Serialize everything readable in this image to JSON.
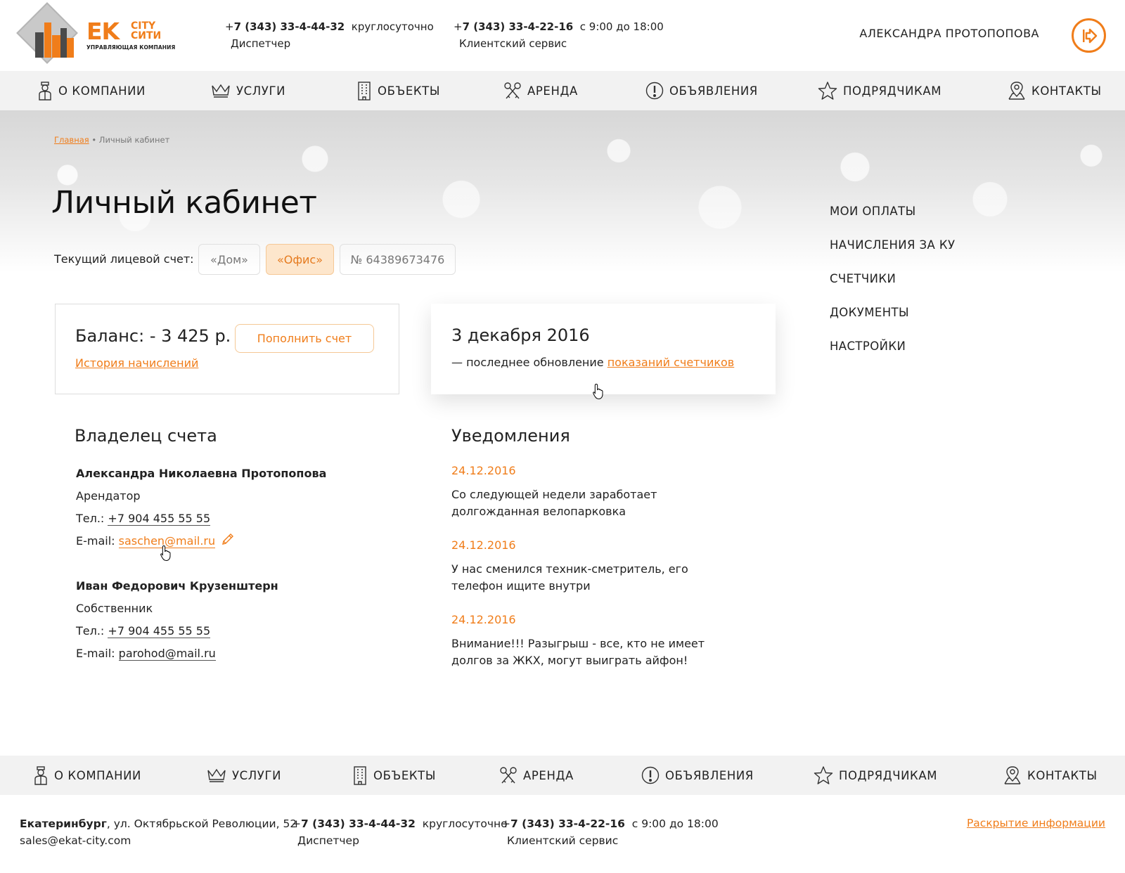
{
  "header": {
    "logo": {
      "ek": "EK",
      "city_en": "CITY",
      "city_ru": "СИТИ",
      "sub": "УПРАВЛЯЮЩАЯ КОМПАНИЯ"
    },
    "phone1": {
      "prefix": "+",
      "number": "7 (343) 33-4-44-32",
      "hours": "круглосуточно",
      "label": "Диспетчер"
    },
    "phone2": {
      "prefix": "+",
      "number": "7 (343) 33-4-22-16",
      "hours": "с 9:00 до 18:00",
      "label": "Клиентский сервис"
    },
    "user_name": "АЛЕКСАНДРА ПРОТОПОПОВА",
    "logout_icon": "logout-arrow-icon",
    "accent_color": "#f07d1a"
  },
  "nav": {
    "items": [
      {
        "label": "О КОМПАНИИ",
        "icon": "doorman-icon"
      },
      {
        "label": "УСЛУГИ",
        "icon": "crown-icon"
      },
      {
        "label": "ОБЪЕКТЫ",
        "icon": "building-icon"
      },
      {
        "label": "АРЕНДА",
        "icon": "keys-icon"
      },
      {
        "label": "ОБЪЯВЛЕНИЯ",
        "icon": "exclamation-icon"
      },
      {
        "label": "ПОДРЯДЧИКАМ",
        "icon": "star-icon"
      },
      {
        "label": "КОНТАКТЫ",
        "icon": "map-pin-icon"
      }
    ]
  },
  "breadcrumb": {
    "home": "Главная",
    "separator": "•",
    "current": "Личный кабинет"
  },
  "page_title": "Личный кабинет",
  "side_menu": [
    "МОИ ОПЛАТЫ",
    "НАЧИСЛЕНИЯ ЗА КУ",
    "СЧЕТЧИКИ",
    "ДОКУМЕНТЫ",
    "НАСТРОЙКИ"
  ],
  "account": {
    "label": "Текущий лицевой счет:",
    "options": [
      "«Дом»",
      "«Офис»",
      "№ 64389673476"
    ],
    "selected": "«Офис»"
  },
  "balance_card": {
    "balance": "Баланс: - 3 425 р.",
    "history_link": "История начислений",
    "topup_button": "Пополнить счет"
  },
  "update_card": {
    "date": "3 декабря 2016",
    "text_prefix": "— последнее обновление",
    "link": "показаний счетчиков"
  },
  "owners": {
    "title": "Владелец счета",
    "tel_label": "Тел.:",
    "email_label": "E-mail:",
    "list": [
      {
        "name": "Александра Николаевна Протопопова",
        "role": "Арендатор",
        "phone": "+7 904 455 55 55",
        "email": "saschen@mail.ru"
      },
      {
        "name": "Иван Федорович Крузенштерн",
        "role": "Собственник",
        "phone": "+7 904 455 55 55",
        "email": "parohod@mail.ru"
      }
    ]
  },
  "notifications": {
    "title": "Уведомления",
    "items": [
      {
        "date": "24.12.2016",
        "text": "Со следующей недели заработает долгожданная велопарковка"
      },
      {
        "date": "24.12.2016",
        "text": "У нас сменился техник-сметритель, его телефон ищите внутри"
      },
      {
        "date": "24.12.2016",
        "text": "Внимание!!! Разыгрыш - все, кто не имеет долгов за ЖКХ, могут выиграть айфон!"
      }
    ]
  },
  "footer": {
    "city": "Екатеринбург",
    "address": ", ул. Октябрьской Революции, 52",
    "email": "sales@ekat-city.com",
    "phone1": {
      "prefix": "+",
      "number": "7 (343) 33-4-44-32",
      "hours": "круглосуточно",
      "label": "Диспетчер"
    },
    "phone2": {
      "prefix": "+",
      "number": "7 (343) 33-4-22-16",
      "hours": "с 9:00 до 18:00",
      "label": "Клиентский сервис"
    },
    "disclosure": "Раскрытие информации"
  }
}
